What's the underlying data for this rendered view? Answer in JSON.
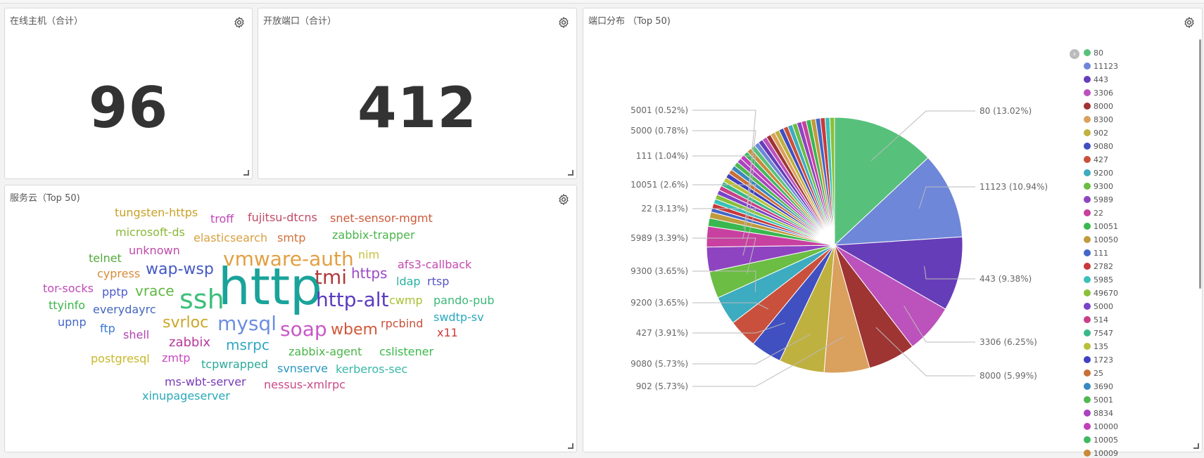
{
  "panels": {
    "online_hosts": {
      "title": "在线主机（合计）",
      "value": "96"
    },
    "open_ports": {
      "title": "开放端口（合计）",
      "value": "412"
    },
    "port_dist": {
      "title": "端口分布 （Top 50)"
    },
    "service_cloud": {
      "title": "服务云（Top 50)"
    }
  },
  "word_cloud": [
    {
      "text": "http",
      "color": "#1aa39a"
    },
    {
      "text": "ssh",
      "color": "#3dbf7b"
    },
    {
      "text": "vmware-auth",
      "color": "#e2a042"
    },
    {
      "text": "mysql",
      "color": "#6c8ee0"
    },
    {
      "text": "http-alt",
      "color": "#5b3bbf"
    },
    {
      "text": "tmi",
      "color": "#b03a3a"
    },
    {
      "text": "soap",
      "color": "#c857c8"
    },
    {
      "text": "wbem",
      "color": "#d2583a"
    },
    {
      "text": "wap-wsp",
      "color": "#4458c4"
    },
    {
      "text": "svrloc",
      "color": "#c9a72a"
    },
    {
      "text": "https",
      "color": "#9a49c4"
    },
    {
      "text": "msrpc",
      "color": "#32a7c0"
    },
    {
      "text": "vrace",
      "color": "#62b844"
    },
    {
      "text": "zabbix",
      "color": "#b8389b"
    },
    {
      "text": "tungsten-https",
      "color": "#c8a126"
    },
    {
      "text": "troff",
      "color": "#c048b8"
    },
    {
      "text": "fujitsu-dtcns",
      "color": "#c24a66"
    },
    {
      "text": "snet-sensor-mgmt",
      "color": "#cc5a3a"
    },
    {
      "text": "microsoft-ds",
      "color": "#8ab83a"
    },
    {
      "text": "elasticsearch",
      "color": "#d8a040"
    },
    {
      "text": "smtp",
      "color": "#d2703a"
    },
    {
      "text": "zabbix-trapper",
      "color": "#4bb54b"
    },
    {
      "text": "unknown",
      "color": "#c04aa8"
    },
    {
      "text": "nim",
      "color": "#c8c13a"
    },
    {
      "text": "telnet",
      "color": "#54a83c"
    },
    {
      "text": "cypress",
      "color": "#d88a3a"
    },
    {
      "text": "afs3-callback",
      "color": "#c24ab0"
    },
    {
      "text": "ldap",
      "color": "#2ab0a0"
    },
    {
      "text": "rtsp",
      "color": "#5555c0"
    },
    {
      "text": "tor-socks",
      "color": "#c04ab8"
    },
    {
      "text": "pptp",
      "color": "#4b5ac8"
    },
    {
      "text": "cwmp",
      "color": "#a8c030"
    },
    {
      "text": "pando-pub",
      "color": "#3cb878"
    },
    {
      "text": "ttyinfo",
      "color": "#3cb44a"
    },
    {
      "text": "everydayrc",
      "color": "#4466c0"
    },
    {
      "text": "swdtp-sv",
      "color": "#2aa8c0"
    },
    {
      "text": "upnp",
      "color": "#4466c8"
    },
    {
      "text": "ftp",
      "color": "#3a7ad0"
    },
    {
      "text": "rpcbind",
      "color": "#c8503a"
    },
    {
      "text": "x11",
      "color": "#d03a3a"
    },
    {
      "text": "shell",
      "color": "#b044b0"
    },
    {
      "text": "zabbix-agent",
      "color": "#4bb54b"
    },
    {
      "text": "cslistener",
      "color": "#3ab84a"
    },
    {
      "text": "postgresql",
      "color": "#c8b82a"
    },
    {
      "text": "zmtp",
      "color": "#c84ac0"
    },
    {
      "text": "tcpwrapped",
      "color": "#2aaa98"
    },
    {
      "text": "svnserve",
      "color": "#2a98c0"
    },
    {
      "text": "kerberos-sec",
      "color": "#3ab8a8"
    },
    {
      "text": "ms-wbt-server",
      "color": "#7a3ab8"
    },
    {
      "text": "nessus-xmlrpc",
      "color": "#c84a88"
    },
    {
      "text": "xinupageserver",
      "color": "#2aa8b8"
    }
  ],
  "chart_data": {
    "type": "pie",
    "title": "端口分布 （Top 50)",
    "labeled_slices": [
      {
        "label": "80",
        "value": 13.02,
        "text": "80 (13.02%)"
      },
      {
        "label": "11123",
        "value": 10.94,
        "text": "11123 (10.94%)"
      },
      {
        "label": "443",
        "value": 9.38,
        "text": "443 (9.38%)"
      },
      {
        "label": "3306",
        "value": 6.25,
        "text": "3306 (6.25%)"
      },
      {
        "label": "8000",
        "value": 5.99,
        "text": "8000 (5.99%)"
      },
      {
        "label": "902",
        "value": 5.73,
        "text": "902 (5.73%)"
      },
      {
        "label": "9080",
        "value": 5.73,
        "text": "9080 (5.73%)"
      },
      {
        "label": "427",
        "value": 3.91,
        "text": "427 (3.91%)"
      },
      {
        "label": "9200",
        "value": 3.65,
        "text": "9200 (3.65%)"
      },
      {
        "label": "9300",
        "value": 3.65,
        "text": "9300 (3.65%)"
      },
      {
        "label": "5989",
        "value": 3.39,
        "text": "5989 (3.39%)"
      },
      {
        "label": "22",
        "value": 3.13,
        "text": "22 (3.13%)"
      },
      {
        "label": "10051",
        "value": 2.6,
        "text": "10051 (2.6%)"
      },
      {
        "label": "111",
        "value": 1.04,
        "text": "111 (1.04%)"
      },
      {
        "label": "5000",
        "value": 0.78,
        "text": "5000 (0.78%)"
      },
      {
        "label": "5001",
        "value": 0.52,
        "text": "5001 (0.52%)"
      }
    ],
    "legend_order": [
      "80",
      "11123",
      "443",
      "3306",
      "8000",
      "8300",
      "902",
      "9080",
      "427",
      "9200",
      "9300",
      "5989",
      "22",
      "10051",
      "10050",
      "111",
      "2782",
      "5985",
      "49670",
      "5000",
      "514",
      "7547",
      "135",
      "1723",
      "25",
      "3690",
      "5001",
      "8834",
      "10000",
      "10005",
      "10009"
    ],
    "legend_position": "right",
    "colors": [
      "#57c17b",
      "#6f87d8",
      "#663db8",
      "#bc52bc",
      "#9e3533",
      "#daa05d",
      "#bfb140",
      "#4050c0",
      "#c9503d",
      "#3dabc0",
      "#6bbd44",
      "#8e44c0",
      "#c840a0",
      "#3ab850",
      "#c09a3c",
      "#4466c8",
      "#c83a3a",
      "#3ac0b8",
      "#8ac03a",
      "#7a44c8",
      "#c84088",
      "#3ab888",
      "#b8c03a",
      "#4040c0",
      "#c8703a",
      "#3a88c0",
      "#50b850",
      "#a844c0",
      "#c040b8",
      "#40b860",
      "#c88a3a"
    ]
  }
}
